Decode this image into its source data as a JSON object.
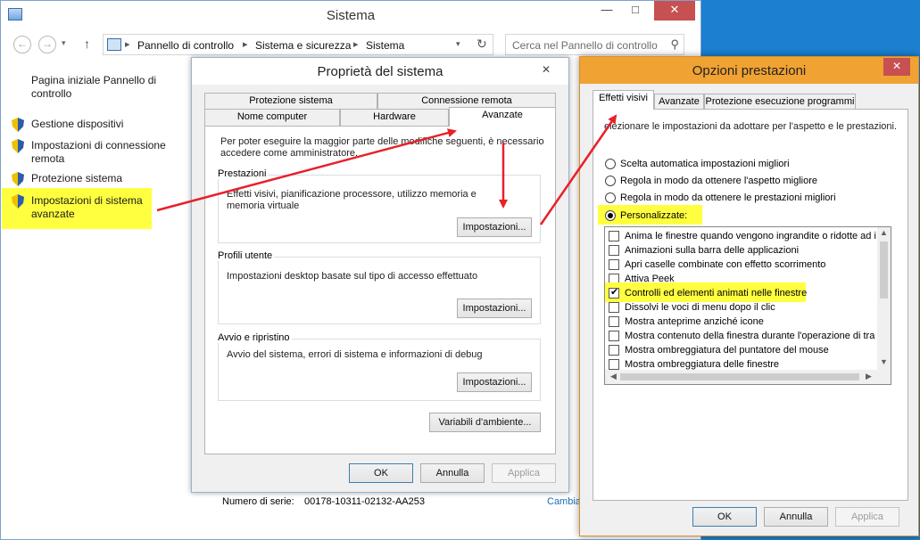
{
  "system_window": {
    "title": "Sistema",
    "minimize": "—",
    "maximize": "□",
    "close": "✕",
    "back": "←",
    "forward": "→",
    "up": "↑",
    "breadcrumbs": [
      "Pannello di controllo",
      "Sistema e sicurezza",
      "Sistema"
    ],
    "search_placeholder": "Cerca nel Pannello di controllo",
    "left_nav": {
      "home": "Pagina iniziale Pannello di controllo",
      "items": [
        {
          "label": "Gestione dispositivi"
        },
        {
          "label": "Impostazioni di connessione remota"
        },
        {
          "label": "Protezione sistema"
        },
        {
          "label": "Impostazioni di sistema avanzate"
        }
      ]
    },
    "serial_label": "Numero di serie:",
    "serial_value": "00178-10311-02132-AA253",
    "change_link": "Cambia"
  },
  "props_dialog": {
    "title": "Proprietà del sistema",
    "close": "✕",
    "tabs_row1": [
      "Protezione sistema",
      "Connessione remota"
    ],
    "tabs_row2": [
      "Nome computer",
      "Hardware",
      "Avanzate"
    ],
    "admin_note": "Per poter eseguire la maggior parte delle modifiche seguenti, è necessario accedere come amministratore.",
    "groups": [
      {
        "title": "Prestazioni",
        "desc": "Effetti visivi, pianificazione processore, utilizzo memoria e memoria virtuale",
        "button": "Impostazioni..."
      },
      {
        "title": "Profili utente",
        "desc": "Impostazioni desktop basate sul tipo di accesso effettuato",
        "button": "Impostazioni..."
      },
      {
        "title": "Avvio e ripristino",
        "desc": "Avvio del sistema, errori di sistema e informazioni di debug",
        "button": "Impostazioni..."
      }
    ],
    "env_button": "Variabili d'ambiente...",
    "ok": "OK",
    "cancel": "Annulla",
    "apply": "Applica"
  },
  "perf_dialog": {
    "title": "Opzioni prestazioni",
    "close": "✕",
    "tabs": [
      "Effetti visivi",
      "Avanzate",
      "Protezione esecuzione programmi"
    ],
    "intro": "elezionare le impostazioni da adottare per l'aspetto e le prestazioni.",
    "radios": [
      {
        "label": "Scelta automatica impostazioni migliori",
        "checked": false
      },
      {
        "label": "Regola in modo da ottenere l'aspetto migliore",
        "checked": false
      },
      {
        "label": "Regola in modo da ottenere le prestazioni migliori",
        "checked": false
      },
      {
        "label": "Personalizzate:",
        "checked": true
      }
    ],
    "options": [
      {
        "label": "Anima le finestre quando vengono ingrandite o ridotte ad i",
        "checked": false
      },
      {
        "label": "Animazioni sulla barra delle applicazioni",
        "checked": false
      },
      {
        "label": "Apri caselle combinate con effetto scorrimento",
        "checked": false
      },
      {
        "label": "Attiva Peek",
        "checked": false
      },
      {
        "label": "Controlli ed elementi animati nelle finestre",
        "checked": true
      },
      {
        "label": "Dissolvi le voci di menu dopo il clic",
        "checked": false
      },
      {
        "label": "Mostra anteprime anziché icone",
        "checked": false
      },
      {
        "label": "Mostra contenuto della finestra durante l'operazione di tra",
        "checked": false
      },
      {
        "label": "Mostra ombreggiatura del puntatore del mouse",
        "checked": false
      },
      {
        "label": "Mostra ombreggiatura delle finestre",
        "checked": false
      }
    ],
    "ok": "OK",
    "cancel": "Annulla",
    "apply": "Applica"
  },
  "colors": {
    "highlight": "#ffff40",
    "arrow": "#e8202a",
    "perf_title": "#f0a233"
  }
}
